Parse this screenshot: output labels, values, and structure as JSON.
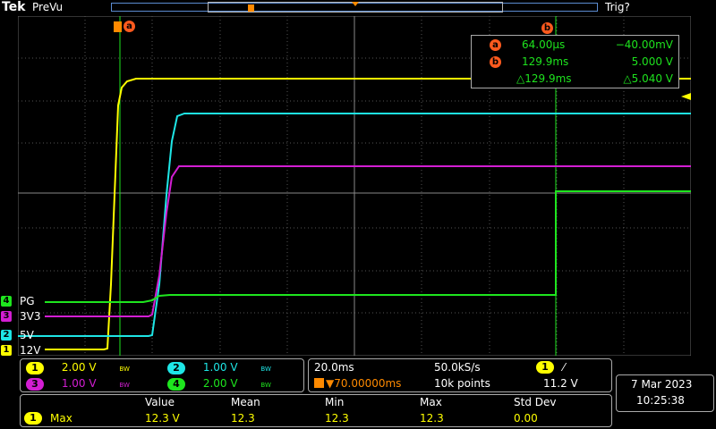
{
  "top": {
    "brand": "Tek",
    "acq_state": "PreVu",
    "trigger_state": "Trig?"
  },
  "cursor_readout": {
    "a_label": "a",
    "a_time": "64.00µs",
    "a_value": "−40.00mV",
    "b_label": "b",
    "b_time": "129.9ms",
    "b_value": "5.000 V",
    "delta_time": "△129.9ms",
    "delta_value": "△5.040 V"
  },
  "cursor_markers": {
    "a": "a",
    "b": "b"
  },
  "channels": [
    {
      "num": "1",
      "label": "12V",
      "scale": "2.00 V",
      "bw": "BW",
      "color": "#ffff00"
    },
    {
      "num": "2",
      "label": "5V",
      "scale": "1.00 V",
      "bw": "BW",
      "color": "#1ee6e6"
    },
    {
      "num": "3",
      "label": "3V3",
      "scale": "1.00 V",
      "bw": "BW",
      "color": "#d31ed3"
    },
    {
      "num": "4",
      "label": "PG",
      "scale": "2.00 V",
      "bw": "BW",
      "color": "#1ee61e"
    }
  ],
  "timebase": {
    "scale": "20.0ms",
    "sample_rate": "50.0kS/s",
    "delay": "▼70.00000ms",
    "record_length": "10k points"
  },
  "trigger": {
    "source": "1",
    "slope": "⁄",
    "level": "11.2 V"
  },
  "datetime": {
    "date": "7 Mar  2023",
    "time": "10:25:38"
  },
  "measurements": {
    "headers": [
      "Value",
      "Mean",
      "Min",
      "Max",
      "Std Dev"
    ],
    "row": {
      "source": "1",
      "name": "Max",
      "value": "12.3 V",
      "mean": "12.3",
      "min": "12.3",
      "max": "12.3",
      "stddev": "0.00"
    }
  }
}
